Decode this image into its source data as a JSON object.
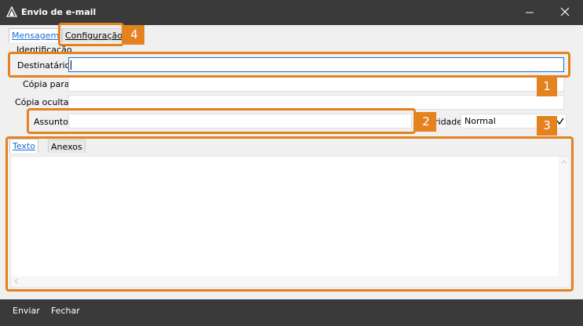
{
  "window": {
    "title": "Envio de e-mail"
  },
  "tabs": {
    "mensagem": "Mensagem",
    "configuracao": "Configuração"
  },
  "form": {
    "group_label": "Identificação",
    "destinatario_label": "Destinatário",
    "destinatario_value": "",
    "copia_para_label": "Cópia para",
    "copia_oculta_label": "Cópia oculta",
    "assunto_label": "Assunto",
    "prioridade_label_visible": "ridade",
    "prioridade_value": "Normal"
  },
  "body_tabs": {
    "texto": "Texto",
    "anexos": "Anexos"
  },
  "footer": {
    "enviar": "Enviar",
    "fechar": "Fechar"
  },
  "callouts": {
    "n1": "1",
    "n2": "2",
    "n3": "3",
    "n4": "4"
  },
  "colors": {
    "accent": "#e3821f",
    "titlebar": "#3a3a3a",
    "link": "#1c6fd0"
  }
}
